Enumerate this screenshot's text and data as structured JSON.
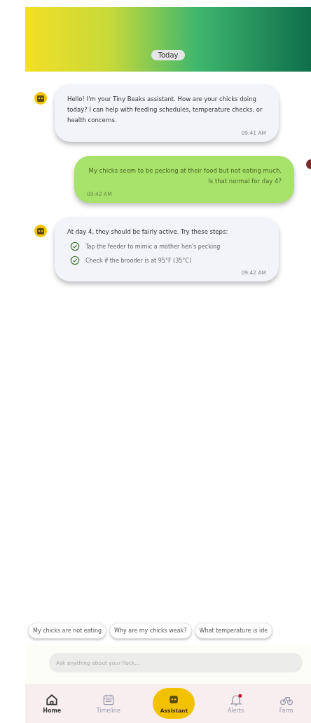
{
  "header": {
    "date_chip": "Today"
  },
  "messages": [
    {
      "kind": "bot",
      "text": "Hello! I'm your Tiny Beaks assistant. How are your chicks doing today? I can help with feeding schedules, temperature checks, or health concerns.",
      "time": "09:41 AM"
    },
    {
      "kind": "user",
      "text": "My chicks seem to be pecking at their food but not eating much. Is that normal for day 4?",
      "time": "09:42 AM"
    },
    {
      "kind": "bot",
      "text": "At day 4, they should be fairly active. Try these steps:",
      "steps": [
        {
          "text": "Tap the feeder to mimic a mother hen's pecking",
          "checked": true
        },
        {
          "text": "Check if the brooder is at 95°F (35°C)",
          "checked": true
        }
      ],
      "time": "09:42 AM"
    }
  ],
  "quick_replies": [
    "My chicks are not eating",
    "Why are my chicks weak?",
    "What temperature is ide"
  ],
  "input": {
    "placeholder": "Ask anything about your flock..."
  },
  "nav": [
    {
      "label": "Home",
      "kind": "home",
      "selected": true,
      "badge": false
    },
    {
      "label": "Timeline",
      "kind": "calendar",
      "selected": false,
      "badge": false
    },
    {
      "label": "Assistant",
      "kind": "robot",
      "selected": false,
      "badge": false
    },
    {
      "label": "Alerts",
      "kind": "bell",
      "selected": false,
      "badge": true
    },
    {
      "label": "Farm",
      "kind": "bike",
      "selected": false,
      "badge": false
    }
  ]
}
